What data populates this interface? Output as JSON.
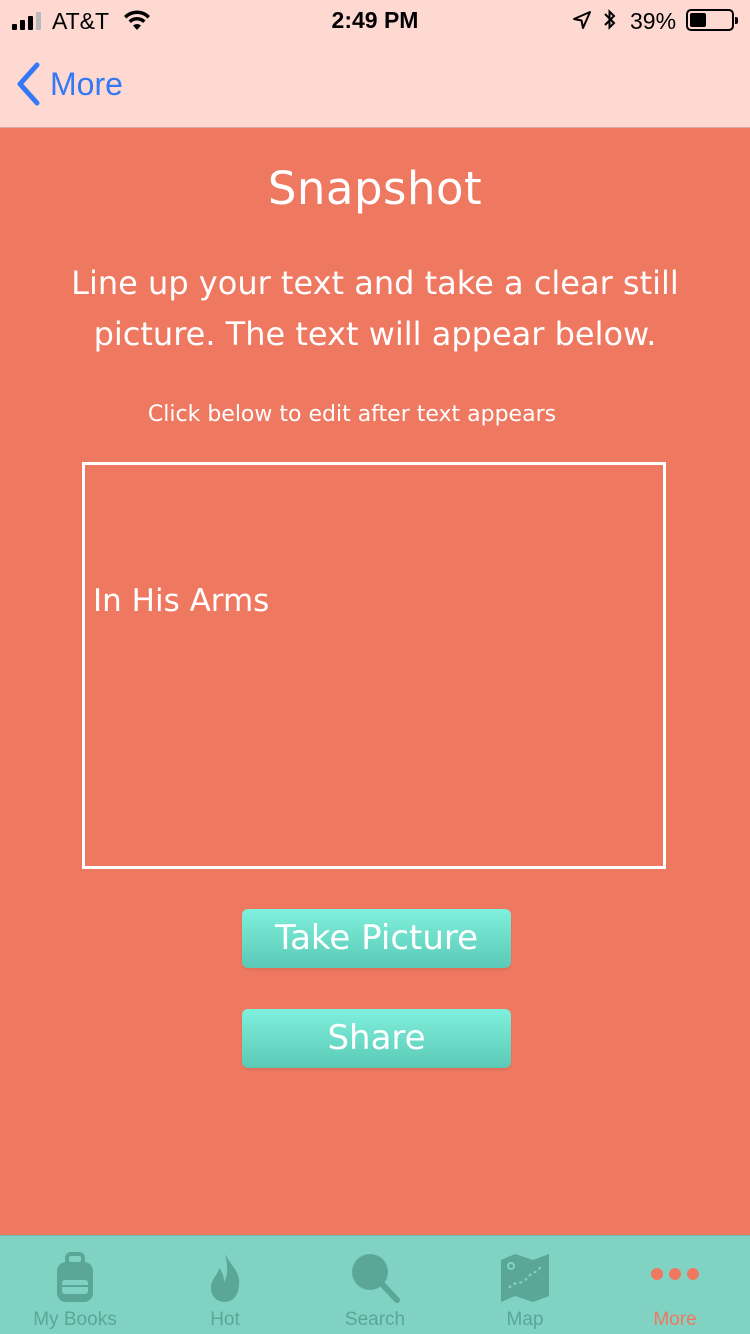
{
  "status_bar": {
    "carrier": "AT&T",
    "time": "2:49 PM",
    "battery_percent": "39%",
    "battery_level": 0.39,
    "signal_bars_filled": 3,
    "signal_bars_total": 4
  },
  "nav": {
    "back_label": "More",
    "back_icon": "chevron-left-icon"
  },
  "main": {
    "title": "Snapshot",
    "instructions": "Line up your text and take a clear still picture. The text will appear below.",
    "hint": "Click below to edit after text appears",
    "recognized_text": "In His Arms",
    "take_picture_label": "Take Picture",
    "share_label": "Share"
  },
  "tabs": [
    {
      "label": "My Books",
      "icon": "backpack-icon",
      "active": false
    },
    {
      "label": "Hot",
      "icon": "flame-icon",
      "active": false
    },
    {
      "label": "Search",
      "icon": "magnifier-icon",
      "active": false
    },
    {
      "label": "Map",
      "icon": "map-icon",
      "active": false
    },
    {
      "label": "More",
      "icon": "more-dots-icon",
      "active": true
    }
  ],
  "colors": {
    "background": "#EF7861",
    "nav_background": "#FDD9D2",
    "accent_blue": "#3478F6",
    "button_teal": "#6FDCC8",
    "tabbar": "#80D3C2",
    "active_tab": "#EF7861"
  }
}
